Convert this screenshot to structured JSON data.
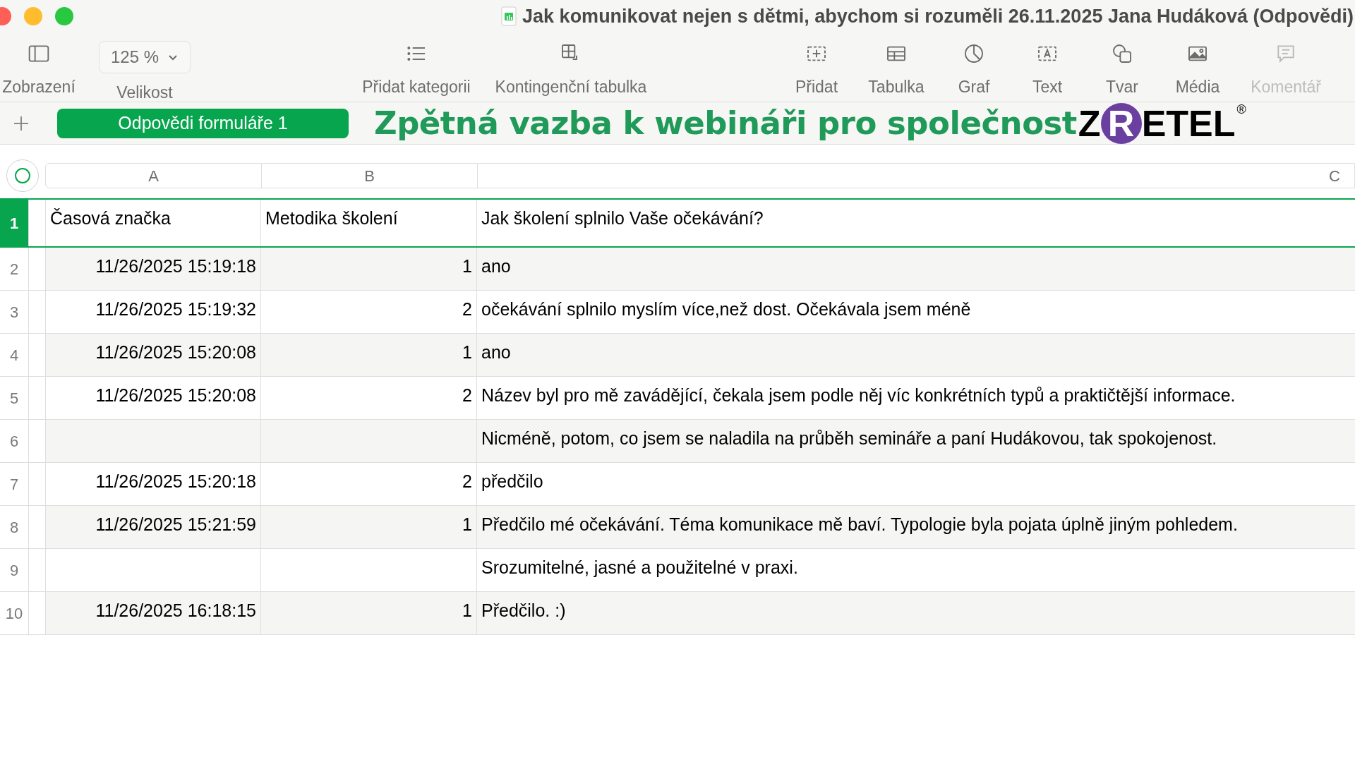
{
  "window": {
    "title": "Jak komunikovat nejen s dětmi, abychom si rozuměli 26.11.2025 Jana Hudáková (Odpovědi)"
  },
  "toolbar": [
    {
      "kind": "view",
      "label": "Zobrazení",
      "disabled": false
    },
    {
      "kind": "zoom",
      "value": "125 %",
      "label": "Velikost",
      "disabled": false
    },
    {
      "kind": "category",
      "label": "Přidat kategorii",
      "disabled": false
    },
    {
      "kind": "pivot",
      "label": "Kontingenční tabulka",
      "disabled": false
    },
    {
      "kind": "insert",
      "label": "Přidat",
      "disabled": false
    },
    {
      "kind": "table",
      "label": "Tabulka",
      "disabled": false
    },
    {
      "kind": "chart",
      "label": "Graf",
      "disabled": false
    },
    {
      "kind": "text",
      "label": "Text",
      "disabled": false
    },
    {
      "kind": "shape",
      "label": "Tvar",
      "disabled": false
    },
    {
      "kind": "media",
      "label": "Média",
      "disabled": false
    },
    {
      "kind": "comment",
      "label": "Komentář",
      "disabled": true
    }
  ],
  "sheet_tabs": [
    {
      "label": "Odpovědi formuláře 1",
      "selected": true
    }
  ],
  "headline": "Zpětná vazba k webináři pro společnost",
  "logo": {
    "before": "Z",
    "circle": "R",
    "after": "ETEL",
    "mark": "®"
  },
  "columns": [
    "A",
    "B",
    "C"
  ],
  "rows": [
    {
      "number": "1",
      "selected": true,
      "cells": [
        "Časová značka",
        "Metodika školení",
        "Jak školení splnilo Vaše očekávání?"
      ]
    },
    {
      "number": "2",
      "selected": false,
      "cells": [
        "11/26/2025 15:19:18",
        "1",
        "ano"
      ]
    },
    {
      "number": "3",
      "selected": false,
      "cells": [
        "11/26/2025 15:19:32",
        "2",
        "očekávání splnilo myslím více,než dost. Očekávala jsem méně"
      ]
    },
    {
      "number": "4",
      "selected": false,
      "cells": [
        "11/26/2025 15:20:08",
        "1",
        "ano"
      ]
    },
    {
      "number": "5",
      "selected": false,
      "cells": [
        "11/26/2025 15:20:08",
        "2",
        "Název byl pro mě zavádějící, čekala jsem podle něj víc konkrétních typů a praktičtější informace."
      ]
    },
    {
      "number": "6",
      "selected": false,
      "cells": [
        "",
        "",
        "Nicméně, potom, co jsem se naladila na průběh semináře a paní Hudákovou, tak spokojenost."
      ]
    },
    {
      "number": "7",
      "selected": false,
      "cells": [
        "11/26/2025 15:20:18",
        "2",
        "předčilo"
      ]
    },
    {
      "number": "8",
      "selected": false,
      "cells": [
        "11/26/2025 15:21:59",
        "1",
        "Předčilo mé očekávání. Téma komunikace mě baví. Typologie byla pojata úplně jiným pohledem."
      ]
    },
    {
      "number": "9",
      "selected": false,
      "cells": [
        "",
        "",
        "Srozumitelné, jasné a použitelné v praxi."
      ]
    },
    {
      "number": "10",
      "selected": false,
      "cells": [
        "11/26/2025 16:18:15",
        "1",
        "Předčilo. :)"
      ]
    }
  ]
}
